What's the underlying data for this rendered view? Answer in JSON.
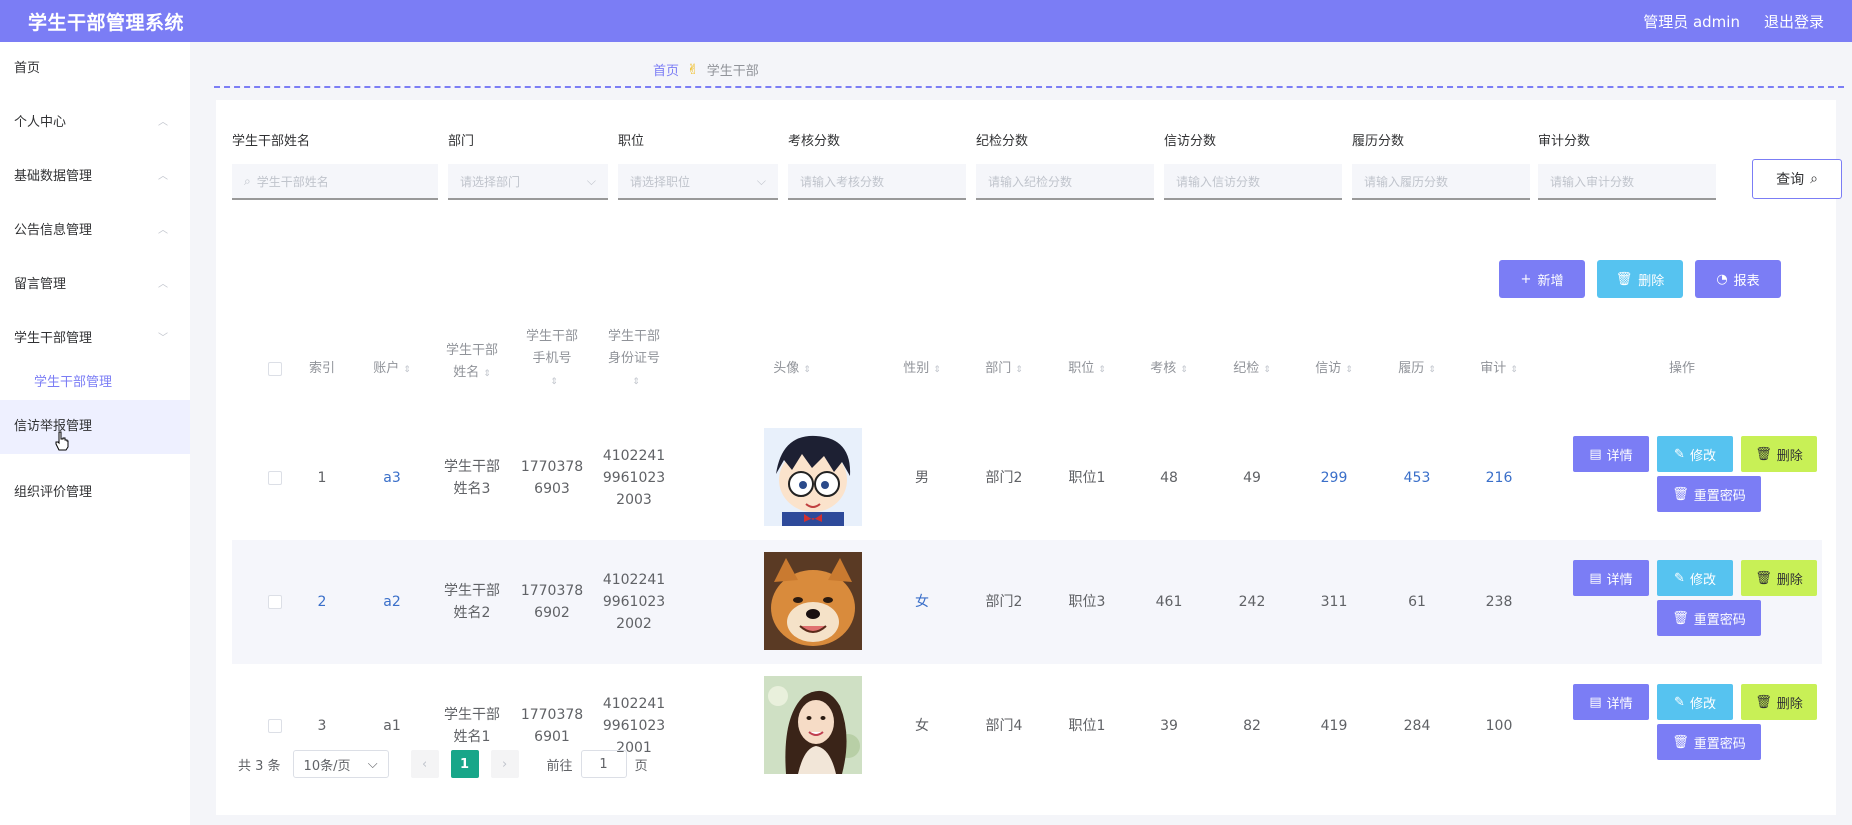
{
  "header": {
    "title": "学生干部管理系统",
    "user": "管理员 admin",
    "logout": "退出登录",
    "bg": "#7b7df5"
  },
  "sidebar": {
    "items": [
      {
        "label": "首页"
      },
      {
        "label": "个人中心"
      },
      {
        "label": "基础数据管理"
      },
      {
        "label": "公告信息管理"
      },
      {
        "label": "留言管理"
      },
      {
        "label": "学生干部管理"
      },
      {
        "label": "信访举报管理"
      },
      {
        "label": "组织评价管理"
      }
    ],
    "sub_item": "学生干部管理"
  },
  "breadcrumb": {
    "home": "首页",
    "current": "学生干部"
  },
  "filters": {
    "name": {
      "label": "学生干部姓名",
      "placeholder": "学生干部姓名"
    },
    "dept": {
      "label": "部门",
      "placeholder": "请选择部门"
    },
    "position": {
      "label": "职位",
      "placeholder": "请选择职位"
    },
    "assess": {
      "label": "考核分数",
      "placeholder": "请输入考核分数"
    },
    "discipline": {
      "label": "纪检分数",
      "placeholder": "请输入纪检分数"
    },
    "petition": {
      "label": "信访分数",
      "placeholder": "请输入信访分数"
    },
    "resume": {
      "label": "履历分数",
      "placeholder": "请输入履历分数"
    },
    "audit": {
      "label": "审计分数",
      "placeholder": "请输入审计分数"
    },
    "query_label": "查询"
  },
  "actions": {
    "add": "新增",
    "delete": "删除",
    "report": "报表"
  },
  "table": {
    "headers": {
      "index": "索引",
      "account": "账户",
      "name_l1": "学生干部",
      "name_l2": "姓名",
      "phone_l1": "学生干部",
      "phone_l2": "手机号",
      "idcard_l1": "学生干部",
      "idcard_l2": "身份证号",
      "avatar": "头像",
      "gender": "性别",
      "dept": "部门",
      "position": "职位",
      "assess": "考核",
      "discipline": "纪检",
      "petition": "信访",
      "resume": "履历",
      "audit": "审计",
      "ops": "操作"
    },
    "rows": [
      {
        "index": "1",
        "account": "a3",
        "name_l1": "学生干部",
        "name_l2": "姓名3",
        "phone_l1": "1770378",
        "phone_l2": "6903",
        "id_l1": "4102241",
        "id_l2": "9961023",
        "id_l3": "2003",
        "gender": "男",
        "dept": "部门2",
        "position": "职位1",
        "assess": "48",
        "discipline": "49",
        "petition": "299",
        "resume": "453",
        "audit": "216"
      },
      {
        "index": "2",
        "account": "a2",
        "name_l1": "学生干部",
        "name_l2": "姓名2",
        "phone_l1": "1770378",
        "phone_l2": "6902",
        "id_l1": "4102241",
        "id_l2": "9961023",
        "id_l3": "2002",
        "gender": "女",
        "dept": "部门2",
        "position": "职位3",
        "assess": "461",
        "discipline": "242",
        "petition": "311",
        "resume": "61",
        "audit": "238"
      },
      {
        "index": "3",
        "account": "a1",
        "name_l1": "学生干部",
        "name_l2": "姓名1",
        "phone_l1": "1770378",
        "phone_l2": "6901",
        "id_l1": "4102241",
        "id_l2": "9961023",
        "id_l3": "2001",
        "gender": "女",
        "dept": "部门4",
        "position": "职位1",
        "assess": "39",
        "discipline": "82",
        "petition": "419",
        "resume": "284",
        "audit": "100"
      }
    ],
    "op_labels": {
      "detail": "详情",
      "edit": "修改",
      "delete": "删除",
      "reset": "重置密码"
    }
  },
  "pager": {
    "total": "共 3 条",
    "page_size": "10条/页",
    "current": "1",
    "goto_prefix": "前往",
    "goto_value": "1",
    "goto_suffix": "页"
  }
}
